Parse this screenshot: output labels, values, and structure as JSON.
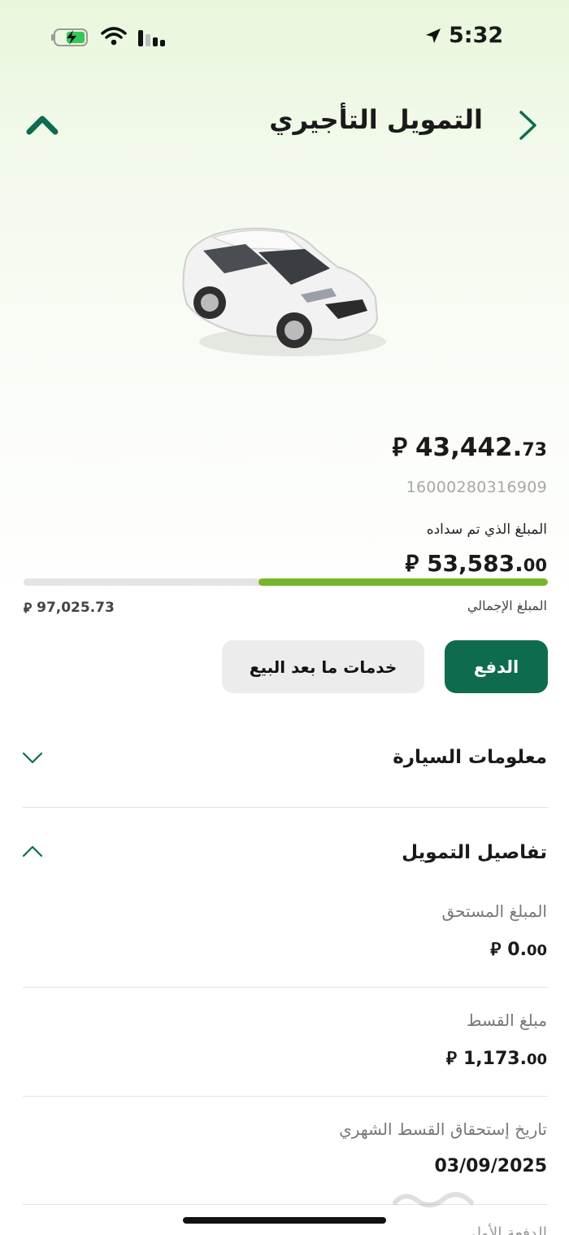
{
  "status_bar": {
    "time": "5:32"
  },
  "header": {
    "title": "التمويل التأجيري"
  },
  "summary": {
    "remaining_int": "43,442.",
    "remaining_dec": "73",
    "contract_number": "16000280316909",
    "paid_label": "المبلغ الذي تم سداده",
    "paid_int": "53,583.",
    "paid_dec": "00",
    "progress_fraction": 0.552,
    "total_label": "المبلغ الإجمالي",
    "total_amount": "97,025.73"
  },
  "actions": {
    "pay_label": "الدفع",
    "aftersales_label": "خدمات ما بعد البيع"
  },
  "sections": {
    "car_info_title": "معلومات السيارة",
    "finance_details_title": "تفاصيل التمويل"
  },
  "details": [
    {
      "label": "المبلغ المستحق",
      "value_int": "0.",
      "value_dec": "00"
    },
    {
      "label": "مبلغ القسط",
      "value_int": "1,173.",
      "value_dec": "00"
    },
    {
      "label": "تاريخ إستحقاق القسط الشهري",
      "value": "03/09/2025"
    }
  ],
  "cut_off_label": "الدفعة الأولى",
  "icons": [
    "location-icon",
    "battery-charging-icon",
    "wifi-icon",
    "signal-icon",
    "back-chevron-icon",
    "collapse-up-icon",
    "riyal-symbol-icon",
    "chevron-down-icon",
    "chevron-up-icon"
  ],
  "colors": {
    "brand_green": "#0e6b4f",
    "progress_green": "#78b62a",
    "track_gray": "#e3e3e3"
  }
}
